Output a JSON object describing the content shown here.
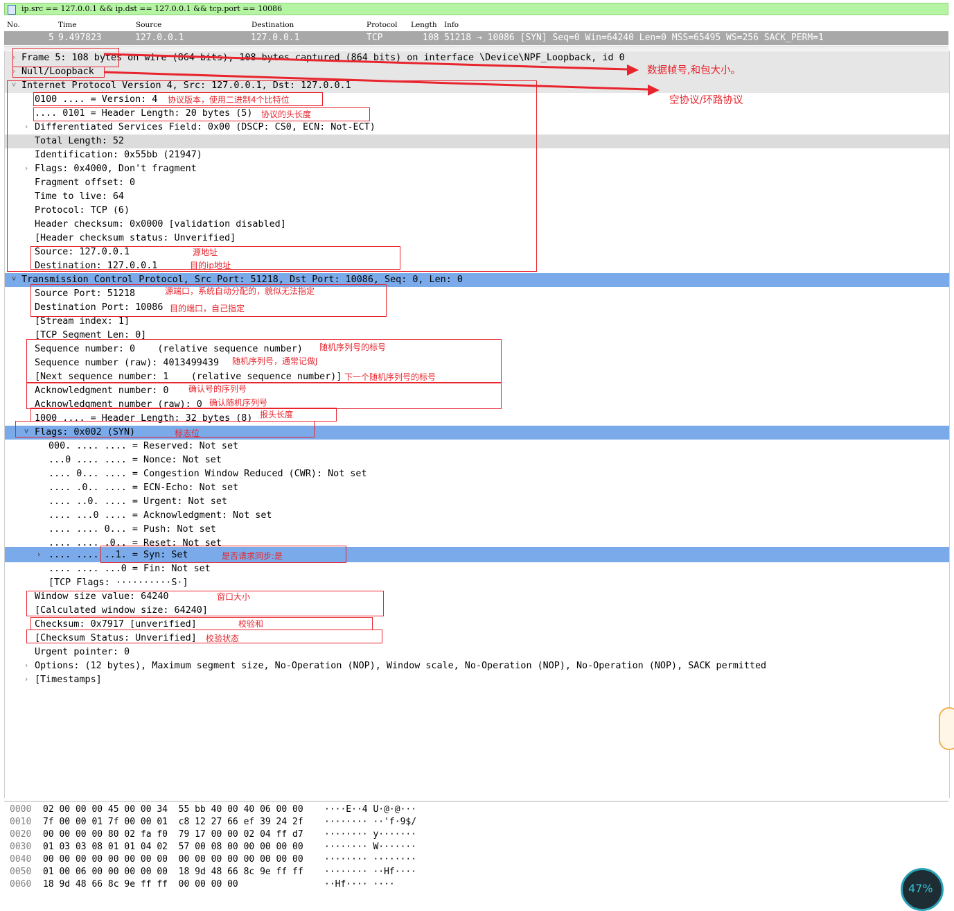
{
  "filter": {
    "text": "ip.src == 127.0.0.1 && ip.dst == 127.0.0.1 && tcp.port == 10086"
  },
  "columns": [
    "No.",
    "Time",
    "Source",
    "Destination",
    "Protocol",
    "Length",
    "Info"
  ],
  "packet": {
    "no": "5",
    "time": "9.497823",
    "src": "127.0.0.1",
    "dst": "127.0.0.1",
    "proto": "TCP",
    "length": "108",
    "info": "51218 → 10086 [SYN] Seq=0 Win=64240 Len=0 MSS=65495 WS=256 SACK_PERM=1"
  },
  "tree": {
    "frame": "Frame 5: 108 bytes on wire (864 bits), 108 bytes captured (864 bits) on interface \\Device\\NPF_Loopback, id 0",
    "null": "Null/Loopback",
    "ipv4": "Internet Protocol Version 4, Src: 127.0.0.1, Dst: 127.0.0.1",
    "ip_version": "0100 .... = Version: 4",
    "ip_hlen": ".... 0101 = Header Length: 20 bytes (5)",
    "ip_dsf": "Differentiated Services Field: 0x00 (DSCP: CS0, ECN: Not-ECT)",
    "ip_total": "Total Length: 52",
    "ip_id": "Identification: 0x55bb (21947)",
    "ip_flags": "Flags: 0x4000, Don't fragment",
    "ip_frag": "Fragment offset: 0",
    "ip_ttl": "Time to live: 64",
    "ip_proto": "Protocol: TCP (6)",
    "ip_cksum": "Header checksum: 0x0000 [validation disabled]",
    "ip_cksum_status": "[Header checksum status: Unverified]",
    "ip_src": "Source: 127.0.0.1",
    "ip_dst": "Destination: 127.0.0.1",
    "tcp": "Transmission Control Protocol, Src Port: 51218, Dst Port: 10086, Seq: 0, Len: 0",
    "tcp_srcport": "Source Port: 51218",
    "tcp_dstport": "Destination Port: 10086",
    "tcp_stream": "[Stream index: 1]",
    "tcp_seglen": "[TCP Segment Len: 0]",
    "tcp_seq": "Sequence number: 0    (relative sequence number)",
    "tcp_seq_raw": "Sequence number (raw): 4013499439",
    "tcp_nextseq": "[Next sequence number: 1    (relative sequence number)]",
    "tcp_ack": "Acknowledgment number: 0",
    "tcp_ack_raw": "Acknowledgment number (raw): 0",
    "tcp_hlen": "1000 .... = Header Length: 32 bytes (8)",
    "tcp_flags": "Flags: 0x002 (SYN)",
    "f_reserved": "000. .... .... = Reserved: Not set",
    "f_nonce": "...0 .... .... = Nonce: Not set",
    "f_cwr": ".... 0... .... = Congestion Window Reduced (CWR): Not set",
    "f_ecn": ".... .0.. .... = ECN-Echo: Not set",
    "f_urg": ".... ..0. .... = Urgent: Not set",
    "f_ack": ".... ...0 .... = Acknowledgment: Not set",
    "f_push": ".... .... 0... = Push: Not set",
    "f_reset": ".... .... .0.. = Reset: Not set",
    "f_syn": ".... .... ..1. = Syn: Set",
    "f_fin": ".... .... ...0 = Fin: Not set",
    "f_tcpflags": "[TCP Flags: ··········S·]",
    "tcp_win": "Window size value: 64240",
    "tcp_calcwin": "[Calculated window size: 64240]",
    "tcp_cksum": "Checksum: 0x7917 [unverified]",
    "tcp_cksum_status": "[Checksum Status: Unverified]",
    "tcp_urgptr": "Urgent pointer: 0",
    "tcp_options": "Options: (12 bytes), Maximum segment size, No-Operation (NOP), Window scale, No-Operation (NOP), No-Operation (NOP), SACK permitted",
    "tcp_ts": "[Timestamps]"
  },
  "notes": {
    "frame": "数据帧号,和包大小。",
    "null": "空协议/环路协议",
    "version": "协议版本，使用二进制4个比特位",
    "hlen": "协议的头长度",
    "src": "源地址",
    "dst": "目的ip地址",
    "srcport": "源端口，系统自动分配的，貌似无法指定",
    "dstport": "目的端口，自己指定",
    "seq": "随机序列号的标号",
    "seqraw": "随机序列号，通常记做J",
    "nextseq": "下一个随机序列号的标号",
    "ack": "确认号的序列号",
    "ackraw": "确认随机序列号",
    "hdrlen": "报头长度",
    "flags": "标志位",
    "syn": "是否请求同步:是",
    "win": "窗口大小",
    "cksum": "校验和",
    "cksumstatus": "校验状态"
  },
  "hex": [
    {
      "off": "0000",
      "bytes": "02 00 00 00 45 00 00 34  55 bb 40 00 40 06 00 00",
      "ascii": "····E··4 U·@·@···"
    },
    {
      "off": "0010",
      "bytes": "7f 00 00 01 7f 00 00 01  c8 12 27 66 ef 39 24 2f",
      "ascii": "········ ··'f·9$/"
    },
    {
      "off": "0020",
      "bytes": "00 00 00 00 80 02 fa f0  79 17 00 00 02 04 ff d7",
      "ascii": "········ y·······"
    },
    {
      "off": "0030",
      "bytes": "01 03 03 08 01 01 04 02  57 00 08 00 00 00 00 00",
      "ascii": "········ W·······"
    },
    {
      "off": "0040",
      "bytes": "00 00 00 00 00 00 00 00  00 00 00 00 00 00 00 00",
      "ascii": "········ ········"
    },
    {
      "off": "0050",
      "bytes": "01 00 06 00 00 00 00 00  18 9d 48 66 8c 9e ff ff",
      "ascii": "········ ··Hf····"
    },
    {
      "off": "0060",
      "bytes": "18 9d 48 66 8c 9e ff ff  00 00 00 00",
      "ascii": "··Hf···· ····"
    }
  ],
  "gauge": {
    "label": "47%"
  }
}
